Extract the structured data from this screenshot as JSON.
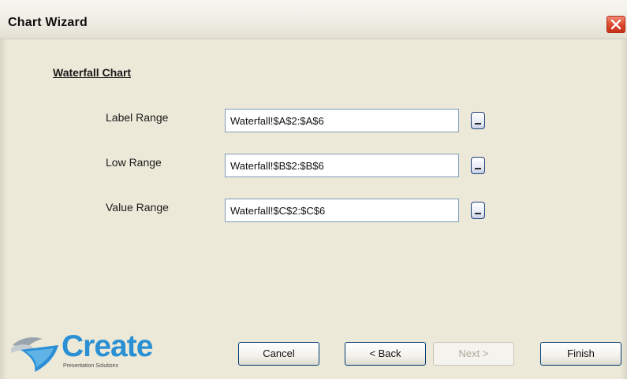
{
  "window": {
    "title": "Chart Wizard"
  },
  "section": {
    "title": "Waterfall Chart"
  },
  "fields": [
    {
      "label": "Label Range",
      "value": "Waterfall!$A$2:$A$6"
    },
    {
      "label": "Low Range",
      "value": "Waterfall!$B$2:$B$6"
    },
    {
      "label": "Value Range",
      "value": "Waterfall!$C$2:$C$6"
    }
  ],
  "logo": {
    "word": "Create",
    "tagline": "Presentation Solutions"
  },
  "buttons": {
    "cancel": "Cancel",
    "back": "< Back",
    "next": "Next >",
    "finish": "Finish"
  },
  "icons": {
    "close": "close-icon",
    "range_picker": "range-picker-icon",
    "logo": "create-logo-icon"
  },
  "colors": {
    "window_bg": "#ece9d8",
    "close_red": "#de4a2f",
    "logo_blue": "#2a8fd3",
    "input_border": "#7f9db9"
  }
}
